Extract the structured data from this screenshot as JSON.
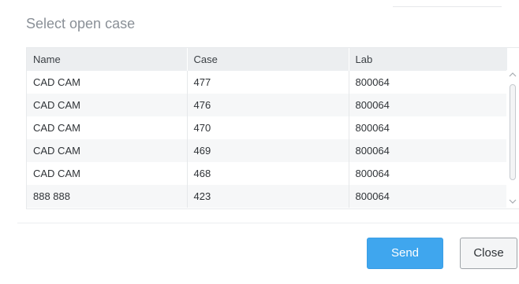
{
  "dialog": {
    "title": "Select open case"
  },
  "table": {
    "headers": {
      "name": "Name",
      "case": "Case",
      "lab": "Lab"
    },
    "rows": [
      {
        "name": "CAD CAM",
        "case": "477",
        "lab": "800064"
      },
      {
        "name": "CAD CAM",
        "case": "476",
        "lab": "800064"
      },
      {
        "name": "CAD CAM",
        "case": "470",
        "lab": "800064"
      },
      {
        "name": "CAD CAM",
        "case": "469",
        "lab": "800064"
      },
      {
        "name": "CAD CAM",
        "case": "468",
        "lab": "800064"
      },
      {
        "name": "888 888",
        "case": "423",
        "lab": "800064"
      }
    ]
  },
  "scrollbar": {
    "up_icon": "chevron-up-icon",
    "down_icon": "chevron-down-icon"
  },
  "buttons": {
    "send_label": "Send",
    "close_label": "Close"
  },
  "colors": {
    "send_button": "#3fa6ee",
    "title_text": "#8a9097",
    "header_bg": "#eceef0"
  }
}
